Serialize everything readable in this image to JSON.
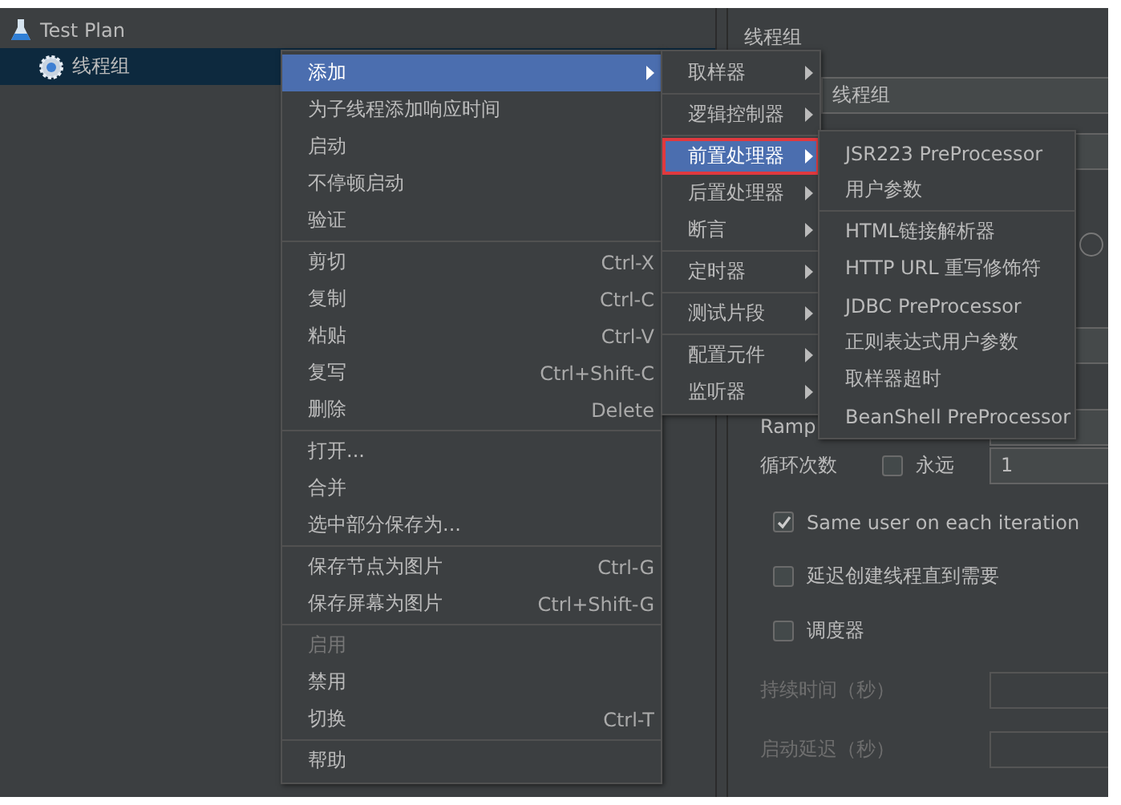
{
  "tree": [
    {
      "label": "Test Plan",
      "kind": "plan",
      "selected": false,
      "children": [
        {
          "label": "线程组",
          "kind": "threads",
          "selected": true
        }
      ]
    }
  ],
  "panel": {
    "title": "线程组",
    "name_value": "线程组",
    "radio_selected": false,
    "ramp_label": "Ramp",
    "loop_label": "循环次数",
    "forever": {
      "label": "永远",
      "checked": false
    },
    "loop_value": "1",
    "checks": [
      {
        "label": "Same user on each iteration",
        "checked": true
      },
      {
        "label": "延迟创建线程直到需要",
        "checked": false
      },
      {
        "label": "调度器",
        "checked": false
      }
    ],
    "disabled_fields": [
      {
        "label": "持续时间（秒）",
        "disabled": true
      },
      {
        "label": "启动延迟（秒）",
        "disabled": true
      }
    ]
  },
  "context_menu": {
    "groups": [
      {
        "items": [
          {
            "label": "添加",
            "submenu": true,
            "selected": true,
            "disabled": false
          },
          {
            "label": "为子线程添加响应时间",
            "submenu": false,
            "selected": false,
            "disabled": false
          },
          {
            "label": "启动",
            "submenu": false,
            "selected": false,
            "disabled": false
          },
          {
            "label": "不停顿启动",
            "submenu": false,
            "selected": false,
            "disabled": false
          },
          {
            "label": "验证",
            "submenu": false,
            "selected": false,
            "disabled": false
          }
        ]
      },
      {
        "items": [
          {
            "label": "剪切",
            "shortcut": "Ctrl-X",
            "submenu": false,
            "selected": false,
            "disabled": false
          },
          {
            "label": "复制",
            "shortcut": "Ctrl-C",
            "submenu": false,
            "selected": false,
            "disabled": false
          },
          {
            "label": "粘贴",
            "shortcut": "Ctrl-V",
            "submenu": false,
            "selected": false,
            "disabled": false
          },
          {
            "label": "复写",
            "shortcut": "Ctrl+Shift-C",
            "submenu": false,
            "selected": false,
            "disabled": false
          },
          {
            "label": "删除",
            "shortcut": "Delete",
            "submenu": false,
            "selected": false,
            "disabled": false
          }
        ]
      },
      {
        "items": [
          {
            "label": "打开...",
            "submenu": false,
            "selected": false,
            "disabled": false
          },
          {
            "label": "合并",
            "submenu": false,
            "selected": false,
            "disabled": false
          },
          {
            "label": "选中部分保存为...",
            "submenu": false,
            "selected": false,
            "disabled": false
          }
        ]
      },
      {
        "items": [
          {
            "label": "保存节点为图片",
            "shortcut": "Ctrl-G",
            "submenu": false,
            "selected": false,
            "disabled": false
          },
          {
            "label": "保存屏幕为图片",
            "shortcut": "Ctrl+Shift-G",
            "submenu": false,
            "selected": false,
            "disabled": false
          }
        ]
      },
      {
        "items": [
          {
            "label": "启用",
            "submenu": false,
            "selected": false,
            "disabled": true
          },
          {
            "label": "禁用",
            "submenu": false,
            "selected": false,
            "disabled": false
          },
          {
            "label": "切换",
            "shortcut": "Ctrl-T",
            "submenu": false,
            "selected": false,
            "disabled": false
          }
        ]
      },
      {
        "items": [
          {
            "label": "帮助",
            "submenu": false,
            "selected": false,
            "disabled": false
          }
        ]
      }
    ]
  },
  "add_submenu": {
    "groups": [
      {
        "items": [
          {
            "label": "取样器",
            "submenu": true,
            "selected": false,
            "outlined": false
          }
        ]
      },
      {
        "items": [
          {
            "label": "逻辑控制器",
            "submenu": true,
            "selected": false,
            "outlined": false
          }
        ]
      },
      {
        "items": [
          {
            "label": "前置处理器",
            "submenu": true,
            "selected": true,
            "outlined": true
          },
          {
            "label": "后置处理器",
            "submenu": true,
            "selected": false,
            "outlined": false
          },
          {
            "label": "断言",
            "submenu": true,
            "selected": false,
            "outlined": false
          }
        ]
      },
      {
        "items": [
          {
            "label": "定时器",
            "submenu": true,
            "selected": false,
            "outlined": false
          }
        ]
      },
      {
        "items": [
          {
            "label": "测试片段",
            "submenu": true,
            "selected": false,
            "outlined": false
          }
        ]
      },
      {
        "items": [
          {
            "label": "配置元件",
            "submenu": true,
            "selected": false,
            "outlined": false
          },
          {
            "label": "监听器",
            "submenu": true,
            "selected": false,
            "outlined": false
          }
        ]
      }
    ]
  },
  "preprocessor_submenu": {
    "groups": [
      {
        "items": [
          {
            "label": "JSR223 PreProcessor",
            "submenu": false,
            "selected": false
          },
          {
            "label": "用户参数",
            "submenu": false,
            "selected": false
          }
        ]
      },
      {
        "items": [
          {
            "label": "HTML链接解析器",
            "submenu": false,
            "selected": false
          },
          {
            "label": "HTTP URL 重写修饰符",
            "submenu": false,
            "selected": false
          },
          {
            "label": "JDBC PreProcessor",
            "submenu": false,
            "selected": false
          },
          {
            "label": "正则表达式用户参数",
            "submenu": false,
            "selected": false
          },
          {
            "label": "取样器超时",
            "submenu": false,
            "selected": false
          },
          {
            "label": "BeanShell PreProcessor",
            "submenu": false,
            "selected": false
          }
        ]
      }
    ]
  }
}
